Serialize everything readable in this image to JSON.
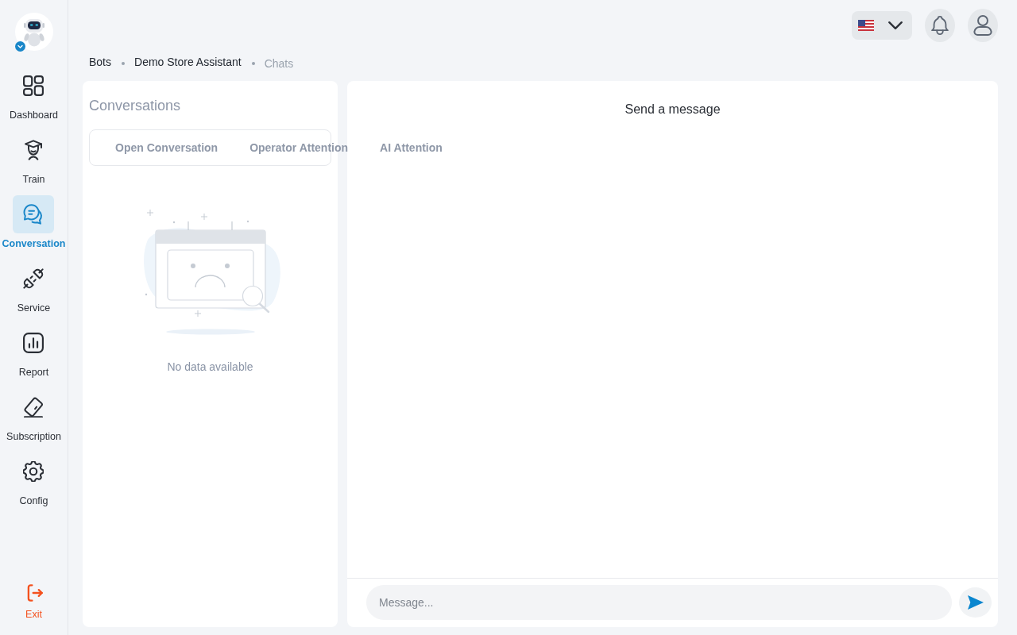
{
  "sidebar": {
    "items": [
      {
        "kind": "dashboard",
        "label": "Dashboard",
        "selected": false
      },
      {
        "kind": "train",
        "label": "Train",
        "selected": false
      },
      {
        "kind": "conversation",
        "label": "Conversation",
        "selected": true
      },
      {
        "kind": "service",
        "label": "Service",
        "selected": false
      },
      {
        "kind": "report",
        "label": "Report",
        "selected": false
      },
      {
        "kind": "subscription",
        "label": "Subscription",
        "selected": false
      },
      {
        "kind": "config",
        "label": "Config",
        "selected": false
      }
    ],
    "exit": {
      "label": "Exit"
    }
  },
  "breadcrumb": [
    {
      "label": "Bots",
      "current": false
    },
    {
      "label": "Demo Store Assistant",
      "current": false
    },
    {
      "label": "Chats",
      "current": true
    }
  ],
  "conversations": {
    "title": "Conversations",
    "tabs": [
      {
        "label": "Open Conversation",
        "selected": false
      },
      {
        "label": "Operator Attention",
        "selected": false
      },
      {
        "label": "AI Attention",
        "selected": false
      }
    ],
    "empty_text": "No data available"
  },
  "chat": {
    "title": "Send a message",
    "message_placeholder": "Message..."
  }
}
